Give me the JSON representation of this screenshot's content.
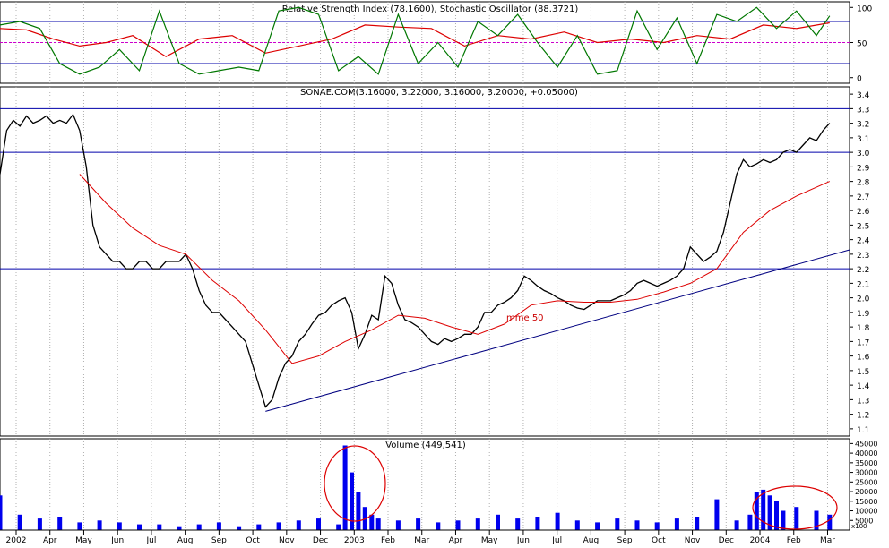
{
  "chart_data": [
    {
      "panel": "oscillators",
      "type": "line",
      "title": "Relative Strength Index (78.1600), Stochastic Oscillator (88.3721)",
      "y_ticks": [
        0,
        50,
        100
      ],
      "ylim": [
        -8,
        108
      ],
      "reference_lines": [
        {
          "value": 80,
          "style": "solid",
          "color": "#0000aa"
        },
        {
          "value": 50,
          "style": "dashed",
          "color": "#cc00cc"
        },
        {
          "value": 20,
          "style": "solid",
          "color": "#0000aa"
        }
      ],
      "series": [
        {
          "name": "Relative Strength Index",
          "color": "#dd0000",
          "x": [
            0,
            4,
            8,
            12,
            16,
            20,
            25,
            30,
            35,
            40,
            45,
            50,
            55,
            60,
            65,
            70,
            75,
            80,
            85,
            90,
            95,
            100,
            105,
            110,
            115,
            120,
            125
          ],
          "values": [
            70,
            68,
            55,
            45,
            50,
            60,
            30,
            55,
            60,
            35,
            45,
            55,
            75,
            72,
            70,
            45,
            60,
            55,
            65,
            50,
            55,
            50,
            60,
            55,
            75,
            70,
            78
          ]
        },
        {
          "name": "Stochastic Oscillator",
          "color": "#007700",
          "x": [
            0,
            3,
            6,
            9,
            12,
            15,
            18,
            21,
            24,
            27,
            30,
            33,
            36,
            39,
            42,
            45,
            48,
            51,
            54,
            57,
            60,
            63,
            66,
            69,
            72,
            75,
            78,
            81,
            84,
            87,
            90,
            93,
            96,
            99,
            102,
            105,
            108,
            111,
            114,
            117,
            120,
            123,
            125
          ],
          "values": [
            75,
            80,
            70,
            20,
            5,
            15,
            40,
            10,
            95,
            20,
            5,
            10,
            15,
            10,
            95,
            100,
            90,
            10,
            30,
            5,
            90,
            20,
            50,
            15,
            80,
            60,
            90,
            50,
            15,
            60,
            5,
            10,
            95,
            40,
            85,
            20,
            90,
            80,
            100,
            70,
            95,
            60,
            88
          ]
        }
      ]
    },
    {
      "panel": "price",
      "type": "line",
      "title": "SONAE.COM(3.16000, 3.22000, 3.16000, 3.20000, +0.05000)",
      "y_ticks": [
        1.1,
        1.2,
        1.3,
        1.4,
        1.5,
        1.6,
        1.7,
        1.8,
        1.9,
        2.0,
        2.1,
        2.2,
        2.3,
        2.4,
        2.5,
        2.6,
        2.7,
        2.8,
        2.9,
        3.0,
        3.1,
        3.2,
        3.3,
        3.4
      ],
      "ylim": [
        1.05,
        3.45
      ],
      "horizontal_lines": [
        3.3,
        3.0,
        2.2
      ],
      "annotation": "mme 50",
      "series": [
        {
          "name": "SONAE.COM",
          "color": "#000000",
          "x": [
            0,
            1,
            2,
            3,
            4,
            5,
            6,
            7,
            8,
            9,
            10,
            11,
            12,
            13,
            14,
            15,
            16,
            17,
            18,
            19,
            20,
            21,
            22,
            23,
            24,
            25,
            26,
            27,
            28,
            29,
            30,
            31,
            32,
            33,
            34,
            35,
            36,
            37,
            38,
            39,
            40,
            41,
            42,
            43,
            44,
            45,
            46,
            47,
            48,
            49,
            50,
            51,
            52,
            53,
            54,
            55,
            56,
            57,
            58,
            59,
            60,
            61,
            62,
            63,
            64,
            65,
            66,
            67,
            68,
            69,
            70,
            71,
            72,
            73,
            74,
            75,
            76,
            77,
            78,
            79,
            80,
            81,
            82,
            83,
            84,
            85,
            86,
            87,
            88,
            89,
            90,
            91,
            92,
            93,
            94,
            95,
            96,
            97,
            98,
            99,
            100,
            101,
            102,
            103,
            104,
            105,
            106,
            107,
            108,
            109,
            110,
            111,
            112,
            113,
            114,
            115,
            116,
            117,
            118,
            119,
            120,
            121,
            122,
            123,
            124,
            125
          ],
          "values": [
            2.85,
            3.15,
            3.22,
            3.18,
            3.25,
            3.2,
            3.22,
            3.25,
            3.2,
            3.22,
            3.2,
            3.26,
            3.15,
            2.9,
            2.5,
            2.35,
            2.3,
            2.25,
            2.25,
            2.2,
            2.2,
            2.25,
            2.25,
            2.2,
            2.2,
            2.25,
            2.25,
            2.25,
            2.3,
            2.2,
            2.05,
            1.95,
            1.9,
            1.9,
            1.85,
            1.8,
            1.75,
            1.7,
            1.55,
            1.4,
            1.25,
            1.3,
            1.45,
            1.55,
            1.6,
            1.7,
            1.75,
            1.82,
            1.88,
            1.9,
            1.95,
            1.98,
            2.0,
            1.9,
            1.65,
            1.75,
            1.88,
            1.85,
            2.15,
            2.1,
            1.95,
            1.85,
            1.83,
            1.8,
            1.75,
            1.7,
            1.68,
            1.72,
            1.7,
            1.72,
            1.75,
            1.75,
            1.8,
            1.9,
            1.9,
            1.95,
            1.97,
            2.0,
            2.05,
            2.15,
            2.12,
            2.08,
            2.05,
            2.03,
            2.0,
            1.98,
            1.95,
            1.93,
            1.92,
            1.95,
            1.98,
            1.98,
            1.98,
            2.0,
            2.02,
            2.05,
            2.1,
            2.12,
            2.1,
            2.08,
            2.1,
            2.12,
            2.15,
            2.2,
            2.35,
            2.3,
            2.25,
            2.28,
            2.32,
            2.45,
            2.65,
            2.85,
            2.95,
            2.9,
            2.92,
            2.95,
            2.93,
            2.95,
            3.0,
            3.02,
            3.0,
            3.05,
            3.1,
            3.08,
            3.15,
            3.2
          ]
        },
        {
          "name": "mme 50",
          "color": "#dd0000",
          "x": [
            12,
            16,
            20,
            24,
            28,
            32,
            36,
            40,
            44,
            48,
            52,
            56,
            60,
            64,
            68,
            72,
            76,
            80,
            84,
            88,
            92,
            96,
            100,
            104,
            108,
            112,
            116,
            120,
            125
          ],
          "values": [
            2.85,
            2.65,
            2.48,
            2.36,
            2.3,
            2.12,
            1.98,
            1.78,
            1.55,
            1.6,
            1.7,
            1.78,
            1.88,
            1.86,
            1.8,
            1.75,
            1.82,
            1.95,
            1.98,
            1.97,
            1.97,
            1.99,
            2.04,
            2.1,
            2.2,
            2.45,
            2.6,
            2.7,
            2.8
          ]
        },
        {
          "name": "trendline",
          "color": "#000080",
          "x": [
            40,
            128
          ],
          "values": [
            1.22,
            2.33
          ]
        }
      ]
    },
    {
      "panel": "volume",
      "type": "bar",
      "title": "Volume (449,541)",
      "y_ticks": [
        5000,
        10000,
        15000,
        20000,
        25000,
        30000,
        35000,
        40000,
        45000
      ],
      "y_unit": "x100",
      "ylim": [
        0,
        47500
      ],
      "x": [
        0,
        3,
        6,
        9,
        12,
        15,
        18,
        21,
        24,
        27,
        30,
        33,
        36,
        39,
        42,
        45,
        48,
        51,
        52,
        53,
        54,
        55,
        56,
        57,
        60,
        63,
        66,
        69,
        72,
        75,
        78,
        81,
        84,
        87,
        90,
        93,
        96,
        99,
        102,
        105,
        108,
        111,
        113,
        114,
        115,
        116,
        117,
        118,
        120,
        123,
        125
      ],
      "values": [
        18000,
        8000,
        6000,
        7000,
        4000,
        5000,
        4000,
        3000,
        3000,
        2000,
        3000,
        4000,
        2000,
        3000,
        4000,
        5000,
        6000,
        3000,
        44000,
        30000,
        20000,
        12000,
        8000,
        6000,
        5000,
        6000,
        4000,
        5000,
        6000,
        8000,
        6000,
        7000,
        9000,
        5000,
        4000,
        6000,
        5000,
        4000,
        6000,
        7000,
        16000,
        5000,
        8000,
        20000,
        21000,
        18000,
        15000,
        10000,
        12000,
        10000,
        8000
      ]
    }
  ],
  "x_axis": {
    "labels": [
      "2002",
      "Apr",
      "May",
      "Jun",
      "Jul",
      "Aug",
      "Sep",
      "Oct",
      "Nov",
      "Dec",
      "2003",
      "Feb",
      "Mar",
      "Apr",
      "May",
      "Jun",
      "Jul",
      "Aug",
      "Sep",
      "Oct",
      "Nov",
      "Dec",
      "2004",
      "Feb",
      "Mar"
    ]
  }
}
